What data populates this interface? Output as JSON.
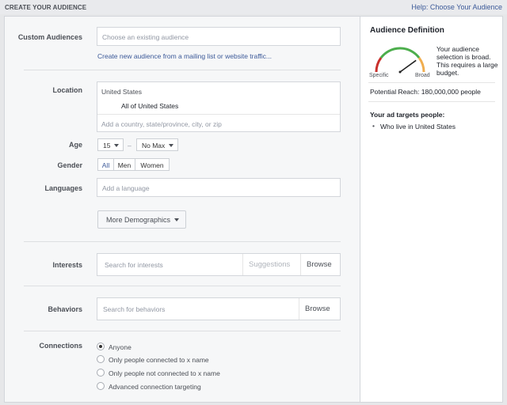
{
  "header": {
    "title": "CREATE YOUR AUDIENCE",
    "help_link": "Help: Choose Your Audience"
  },
  "form": {
    "custom_audiences": {
      "label": "Custom Audiences",
      "placeholder": "Choose an existing audience",
      "create_link": "Create new audience from a mailing list or website traffic..."
    },
    "location": {
      "label": "Location",
      "country": "United States",
      "scope": "All of United States",
      "placeholder": "Add a country, state/province, city, or zip"
    },
    "age": {
      "label": "Age",
      "min": "15",
      "separator": "–",
      "max": "No Max"
    },
    "gender": {
      "label": "Gender",
      "options": [
        "All",
        "Men",
        "Women"
      ],
      "selected": "All"
    },
    "languages": {
      "label": "Languages",
      "placeholder": "Add a language"
    },
    "more_demographics": "More Demographics",
    "interests": {
      "label": "Interests",
      "placeholder": "Search for interests",
      "suggestions": "Suggestions",
      "browse": "Browse"
    },
    "behaviors": {
      "label": "Behaviors",
      "placeholder": "Search for behaviors",
      "browse": "Browse"
    },
    "connections": {
      "label": "Connections",
      "options": [
        "Anyone",
        "Only people connected to x name",
        "Only people not connected to x name",
        "Advanced connection targeting"
      ],
      "selected_index": 0
    }
  },
  "definition": {
    "title": "Audience Definition",
    "gauge_left": "Specific",
    "gauge_right": "Broad",
    "gauge_level": 0.8,
    "description": "Your audience selection is broad. This requires a large budget.",
    "reach": "Potential Reach: 180,000,000 people",
    "targets_title": "Your ad targets people:",
    "targets": [
      "Who live in United States"
    ]
  },
  "colors": {
    "link": "#3b5998",
    "gauge_red": "#c9302c",
    "gauge_green": "#4cae4c",
    "gauge_orange": "#f0ad4e"
  }
}
